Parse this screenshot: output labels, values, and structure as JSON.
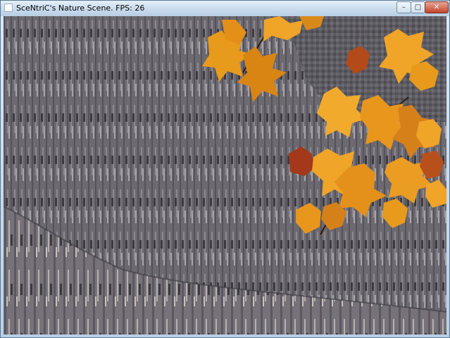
{
  "window": {
    "title": "SceNtriC's Nature Scene. FPS: 26"
  },
  "controls": {
    "minimize_icon": "minimize-icon",
    "maximize_icon": "maximize-icon",
    "close_icon": "close-icon"
  },
  "scene": {
    "bark_color": "#6c6970",
    "leaf_color": "#e89a1c",
    "dark_leaf_color": "#a8421a"
  }
}
